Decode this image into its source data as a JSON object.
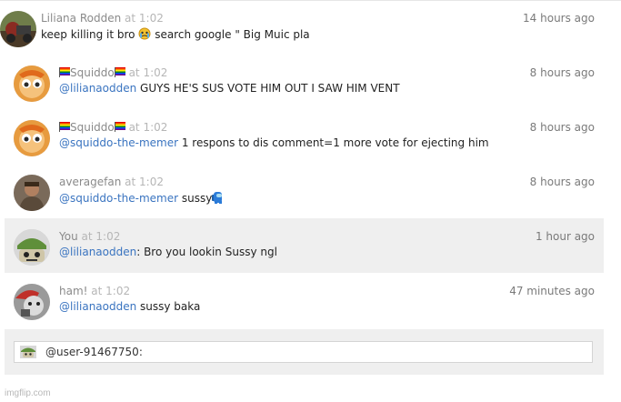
{
  "comments": [
    {
      "username": "Liliana Rodden",
      "at": "at 1:02",
      "time": "14 hours ago",
      "text": "keep killing it bro",
      "emoji": "crying-face-emoji",
      "text2": " search google \" Big Muic pla"
    },
    {
      "username": "Squiddo",
      "flag_icon": "rainbow-flag-icon",
      "at": "at 1:02",
      "time": "8 hours ago",
      "mention": "@lilianaodden",
      "text": " GUYS HE'S SUS VOTE HIM OUT I SAW HIM VENT"
    },
    {
      "username": "Squiddo",
      "flag_icon": "rainbow-flag-icon",
      "at": "at 1:02",
      "time": "8 hours ago",
      "mention": "@squiddo-the-memer",
      "text": " 1 respons to dis comment=1 more vote for ejecting him"
    },
    {
      "username": "averagefan",
      "at": "at 1:02",
      "time": "8 hours ago",
      "mention": "@squiddo-the-memer",
      "text": " sussy",
      "emoji": "crewmate-emoji"
    },
    {
      "username": "You",
      "at": "at 1:02",
      "time": "1 hour ago",
      "mention": "@lilianaodden",
      "text": ": Bro you lookin Sussy ngl"
    },
    {
      "username": "ham!",
      "at": "at 1:02",
      "time": "47 minutes ago",
      "mention": "@lilianaodden",
      "text": " sussy baka"
    }
  ],
  "compose": {
    "text": "@user-91467750:"
  },
  "footer": {
    "watermark": "imgflip.com"
  }
}
